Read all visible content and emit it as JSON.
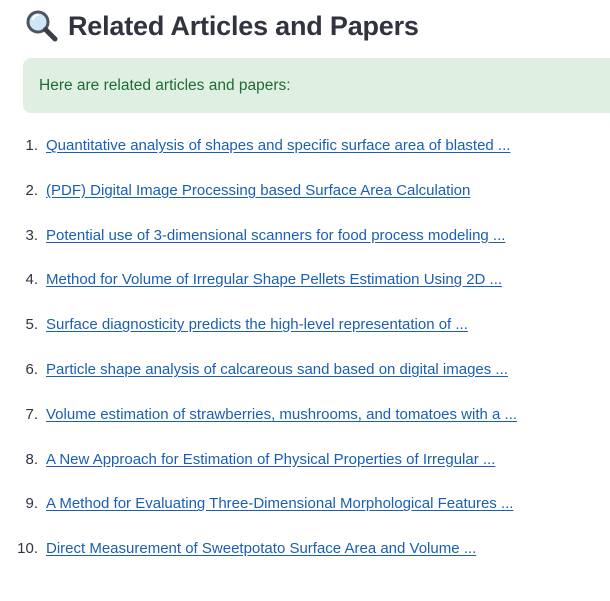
{
  "header": {
    "icon": "magnifying-glass-icon",
    "title": "Related Articles and Papers"
  },
  "info": {
    "message": "Here are related articles and papers:",
    "background": "#dff0e3",
    "text_color": "#1e6b34"
  },
  "articles": [
    {
      "number": "1.",
      "title": "Quantitative analysis of shapes and specific surface area of blasted ..."
    },
    {
      "number": "2.",
      "title": "(PDF) Digital Image Processing based Surface Area Calculation"
    },
    {
      "number": "3.",
      "title": "Potential use of 3-dimensional scanners for food process modeling ..."
    },
    {
      "number": "4.",
      "title": "Method for Volume of Irregular Shape Pellets Estimation Using 2D ..."
    },
    {
      "number": "5.",
      "title": "Surface diagnosticity predicts the high-level representation of ..."
    },
    {
      "number": "6.",
      "title": "Particle shape analysis of calcareous sand based on digital images ..."
    },
    {
      "number": "7.",
      "title": "Volume estimation of strawberries, mushrooms, and tomatoes with a ..."
    },
    {
      "number": "8.",
      "title": "A New Approach for Estimation of Physical Properties of Irregular ..."
    },
    {
      "number": "9.",
      "title": "A Method for Evaluating Three-Dimensional Morphological Features ..."
    },
    {
      "number": "10.",
      "title": "Direct Measurement of Sweetpotato Surface Area and Volume ..."
    }
  ],
  "colors": {
    "link": "#1a5fb4",
    "text": "#31333f"
  }
}
